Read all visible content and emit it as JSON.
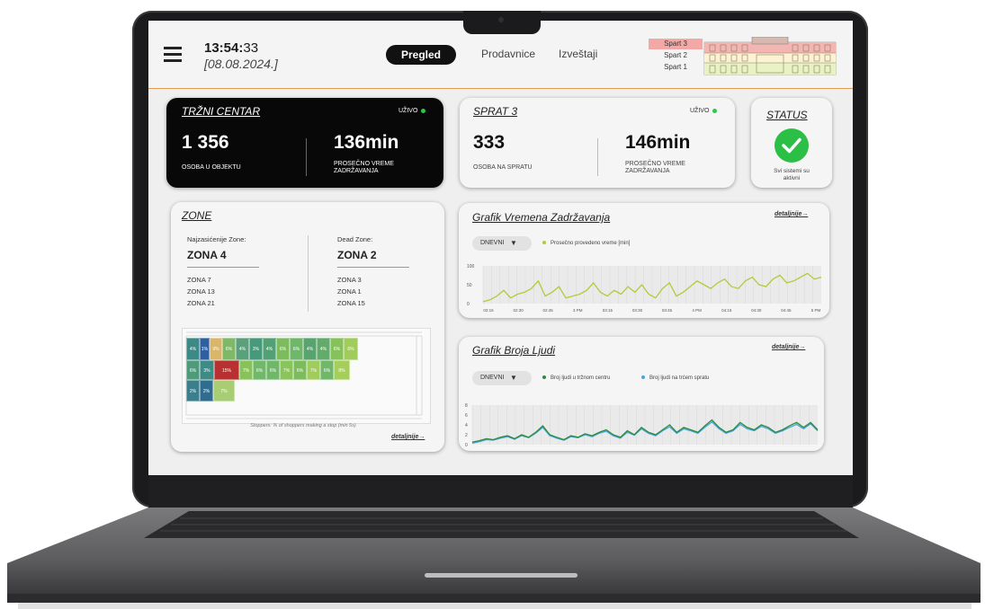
{
  "header": {
    "time_main": "13:54:",
    "time_sec": "33",
    "date": "[08.08.2024.]",
    "nav": {
      "active": "Pregled",
      "stores": "Prodavnice",
      "reports": "Izveštaji"
    },
    "floors": [
      "Spart 3",
      "Spart 2",
      "Spart 1"
    ]
  },
  "mall_card": {
    "title": "TRŽNI CENTAR",
    "live": "UŽIVO",
    "count": "1 356",
    "count_label": "OSOBA U OBJEKTU",
    "time": "136min",
    "time_label_1": "PROSEČNO VREME",
    "time_label_2": "ZADRŽAVANJA"
  },
  "floor_card": {
    "title": "SPRAT 3",
    "live": "UŽIVO",
    "count": "333",
    "count_label": "OSOBA NA SPRATU",
    "time": "146min",
    "time_label_1": "PROSEČNO VREME",
    "time_label_2": "ZADRŽAVANJA"
  },
  "status_card": {
    "title": "STATUS",
    "text_1": "Svi sistemi su",
    "text_2": "aktivni"
  },
  "zones_card": {
    "title": "ZONE",
    "busy_label": "Najzasićenije Zone:",
    "busy_main": "ZONA 4",
    "busy_list": [
      "ZONA 7",
      "ZONA 13",
      "ZONA 21"
    ],
    "dead_label": "Dead Zone:",
    "dead_main": "ZONA 2",
    "dead_list": [
      "ZONA 3",
      "ZONA 1",
      "ZONA 15"
    ],
    "map_caption": "Stoppers: % of shoppers making a stop (min 5s)",
    "more": "detaljnije→",
    "heatmap": [
      {
        "label": "4%",
        "color": "#3c8a86"
      },
      {
        "label": "1%",
        "color": "#2f5fa3"
      },
      {
        "label": "9%",
        "color": "#d9b668"
      },
      {
        "label": "6%",
        "color": "#7fb866"
      },
      {
        "label": "4%",
        "color": "#5aa07a"
      },
      {
        "label": "3%",
        "color": "#46997a"
      },
      {
        "label": "4%",
        "color": "#52a174"
      },
      {
        "label": "6%",
        "color": "#7cbc5c"
      },
      {
        "label": "6%",
        "color": "#6fb86a"
      },
      {
        "label": "4%",
        "color": "#58a370"
      },
      {
        "label": "4%",
        "color": "#62ab6a"
      },
      {
        "label": "6%",
        "color": "#86c25a"
      },
      {
        "label": "6%",
        "color": "#9fcc5a"
      },
      {
        "label": "6%",
        "color": "#4d9b7a"
      },
      {
        "label": "3%",
        "color": "#3c8b86"
      },
      {
        "label": "15%",
        "color": "#b83030"
      },
      {
        "label": "7%",
        "color": "#88c35a"
      },
      {
        "label": "6%",
        "color": "#72b86a"
      },
      {
        "label": "6%",
        "color": "#6fb86a"
      },
      {
        "label": "7%",
        "color": "#8ac45a"
      },
      {
        "label": "6%",
        "color": "#7cbc5c"
      },
      {
        "label": "7%",
        "color": "#9fcc5a"
      },
      {
        "label": "6%",
        "color": "#6fb86a"
      },
      {
        "label": "8%",
        "color": "#a6cf5a"
      },
      {
        "label": "2%",
        "color": "#3c7f8c"
      },
      {
        "label": "2%",
        "color": "#2f6d90"
      },
      {
        "label": "7%",
        "color": "#a8cd72"
      }
    ]
  },
  "time_chart_card": {
    "title": "Grafik Vremena Zadržavanja",
    "more": "detaljnije→",
    "select": "DNEVNI",
    "select_arrow": "▼",
    "legend": "Prosečno provedeno vreme [min]",
    "series_color": "#b5c93a"
  },
  "people_chart_card": {
    "title": "Grafik Broja Ljudi",
    "more": "detaljnije→",
    "select": "DNEVNI",
    "select_arrow": "▼",
    "legend_1": "Broj ljudi u tržnom centru",
    "legend_2": "Broj ljudi na trćem spratu",
    "color_1": "#2e8b3c",
    "color_2": "#4aa3e0"
  },
  "chart_data": [
    {
      "type": "line",
      "title": "Grafik Vremena Zadržavanja",
      "x": [
        "02:15",
        "02:30",
        "02:45",
        "3 PM",
        "03:15",
        "03:30",
        "03:45",
        "4 PM",
        "04:15",
        "04:30",
        "04:45",
        "5 PM"
      ],
      "y_ticks": [
        0,
        50,
        100
      ],
      "ylim": [
        0,
        100
      ],
      "series": [
        {
          "name": "Prosečno provedeno vreme [min]",
          "values": [
            5,
            10,
            20,
            35,
            15,
            25,
            30,
            40,
            60,
            20,
            30,
            45,
            15,
            20,
            25,
            35,
            55,
            30,
            20,
            35,
            25,
            45,
            30,
            50,
            25,
            15,
            40,
            55,
            20,
            30,
            45,
            60,
            50,
            40,
            55,
            65,
            45,
            40,
            60,
            70,
            50,
            45,
            65,
            75,
            55,
            60,
            70,
            80,
            65,
            70
          ]
        }
      ]
    },
    {
      "type": "line",
      "title": "Grafik Broja Ljudi",
      "y_ticks": [
        0,
        2,
        4,
        6,
        8
      ],
      "ylim": [
        0,
        8
      ],
      "series": [
        {
          "name": "Broj ljudi u tržnom centru",
          "values": [
            0.5,
            0.8,
            1.2,
            1.0,
            1.5,
            1.8,
            1.2,
            2.0,
            1.5,
            2.5,
            3.8,
            2.0,
            1.5,
            1.0,
            1.8,
            1.5,
            2.2,
            1.8,
            2.5,
            3.0,
            2.0,
            1.5,
            2.8,
            2.0,
            3.5,
            2.5,
            2.0,
            3.0,
            4.0,
            2.5,
            3.5,
            3.0,
            2.5,
            3.8,
            5.0,
            3.5,
            2.5,
            3.0,
            4.5,
            3.5,
            3.0,
            4.0,
            3.5,
            2.5,
            3.0,
            3.8,
            4.5,
            3.5,
            4.5,
            3.0
          ]
        },
        {
          "name": "Broj ljudi na trćem spratu",
          "values": [
            0.3,
            0.6,
            1.0,
            0.9,
            1.3,
            1.6,
            1.1,
            1.8,
            1.4,
            2.3,
            3.5,
            1.8,
            1.3,
            0.9,
            1.6,
            1.4,
            2.0,
            1.6,
            2.3,
            2.7,
            1.8,
            1.3,
            2.5,
            1.9,
            3.2,
            2.3,
            1.8,
            2.8,
            3.6,
            2.3,
            3.2,
            2.8,
            2.3,
            3.5,
            4.6,
            3.2,
            2.3,
            2.8,
            4.1,
            3.2,
            2.8,
            3.7,
            3.2,
            2.3,
            2.8,
            3.5,
            4.1,
            3.2,
            4.2,
            2.8
          ]
        }
      ]
    }
  ]
}
